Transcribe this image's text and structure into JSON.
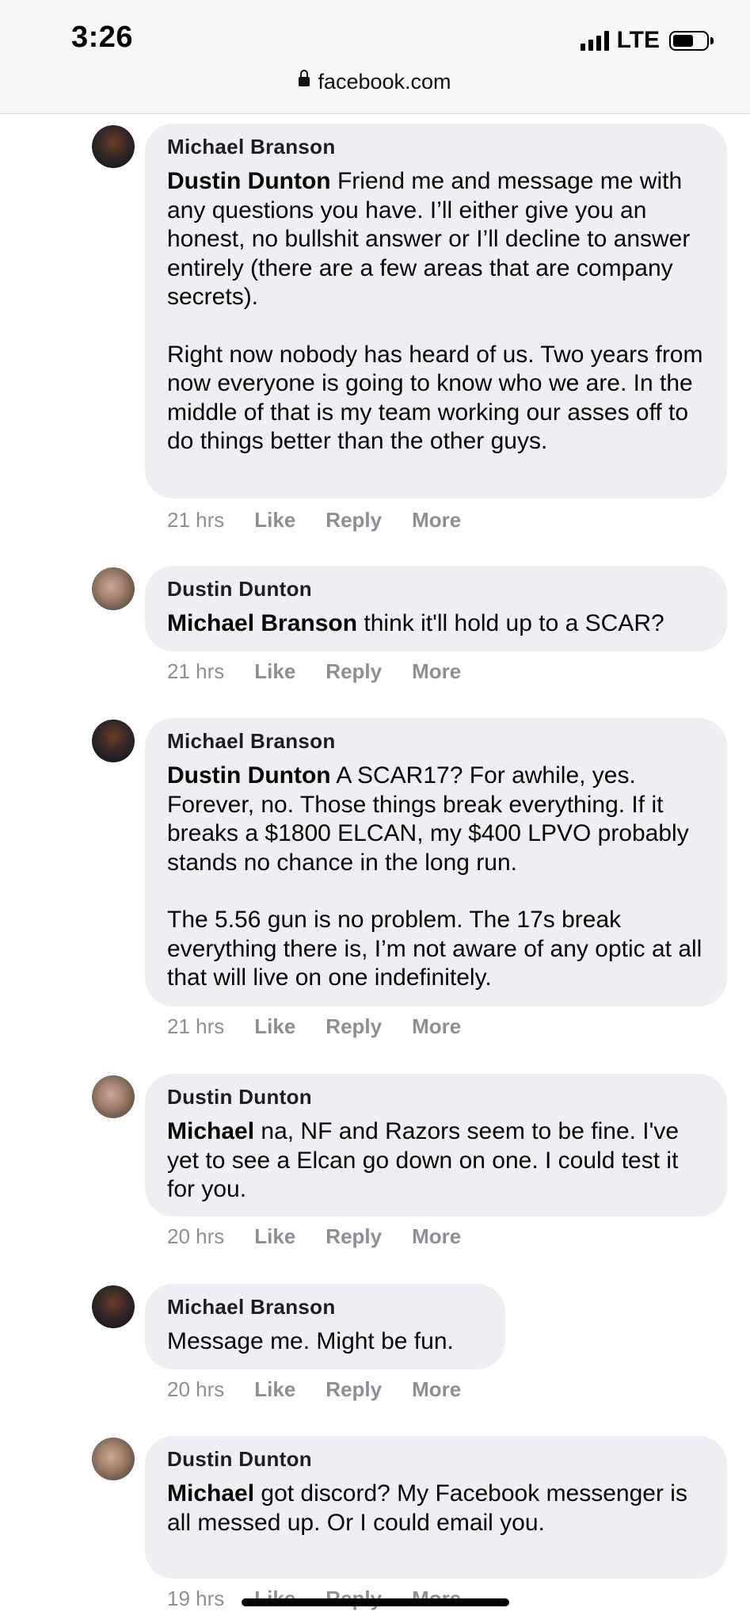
{
  "status_bar": {
    "time": "3:26",
    "network": "LTE"
  },
  "address_bar": {
    "domain": "facebook.com"
  },
  "actions": {
    "like": "Like",
    "reply": "Reply",
    "more": "More"
  },
  "comments": [
    {
      "author": "Michael Branson",
      "mention": "Dustin Dunton",
      "text": "Friend me and message me with any questions you have. I’ll either give you an honest, no bullshit answer or I’ll decline to answer entirely (there are a few areas that are company secrets).",
      "text2": "Right now nobody has heard of us. Two years from now everyone is going to know who we are. In the middle of that is my team working our asses off to do things better than the other guys.",
      "time": "21 hrs"
    },
    {
      "author": "Dustin Dunton",
      "mention": "Michael Branson",
      "text": "think it'll hold up to a SCAR?",
      "time": "21 hrs"
    },
    {
      "author": "Michael Branson",
      "mention": "Dustin Dunton",
      "text": "A SCAR17? For awhile, yes. Forever, no. Those things break everything. If it breaks a $1800 ELCAN, my $400 LPVO probably stands no chance in the long run.",
      "text2": "The 5.56 gun is no problem. The 17s break everything there is, I’m not aware of any optic at all that will live on one indefinitely.",
      "time": "21 hrs"
    },
    {
      "author": "Dustin Dunton",
      "mention": "Michael",
      "text": "na, NF and Razors seem to be fine. I've yet to see a Elcan go down on one. I could test it for you.",
      "time": "20 hrs"
    },
    {
      "author": "Michael Branson",
      "mention": "",
      "text": "Message me. Might be fun.",
      "time": "20 hrs"
    },
    {
      "author": "Dustin Dunton",
      "mention": "Michael",
      "text": "got discord? My Facebook messenger is all messed up. Or I could email you.",
      "time": "19 hrs"
    }
  ]
}
